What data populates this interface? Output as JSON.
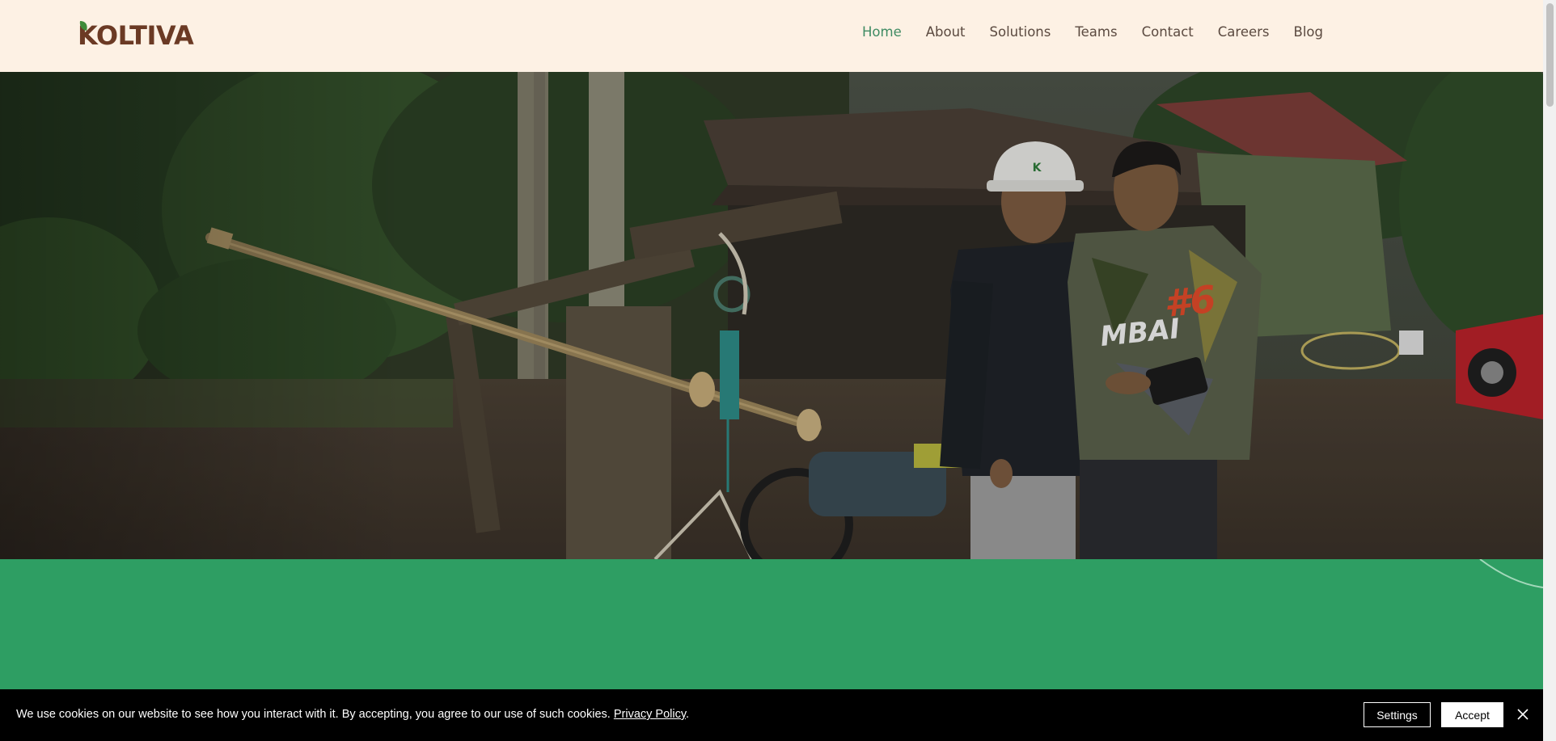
{
  "header": {
    "logo_text": "KOLTIVA",
    "nav": [
      {
        "label": "Home",
        "active": true
      },
      {
        "label": "About",
        "active": false
      },
      {
        "label": "Solutions",
        "active": false
      },
      {
        "label": "Teams",
        "active": false
      },
      {
        "label": "Contact",
        "active": false
      },
      {
        "label": "Careers",
        "active": false
      },
      {
        "label": "Blog",
        "active": false
      }
    ]
  },
  "hero": {
    "helmet_letter": "K",
    "shirt_text": "MBAI",
    "shirt_number": "#6"
  },
  "cookie": {
    "message": "We use cookies on our website to see how you interact with it. By accepting, you agree to our use of such cookies.",
    "privacy_link": "Privacy Policy",
    "period": ".",
    "settings_label": "Settings",
    "accept_label": "Accept"
  },
  "colors": {
    "header_bg": "#fdf1e4",
    "brand_brown": "#6b3a24",
    "brand_leaf": "#3f8b3a",
    "nav_active": "#3f8b63",
    "green_band": "#2e9e63",
    "cookie_bg": "#000000"
  },
  "icons": {
    "logo_leaf": "leaf-icon",
    "close": "close-icon"
  }
}
